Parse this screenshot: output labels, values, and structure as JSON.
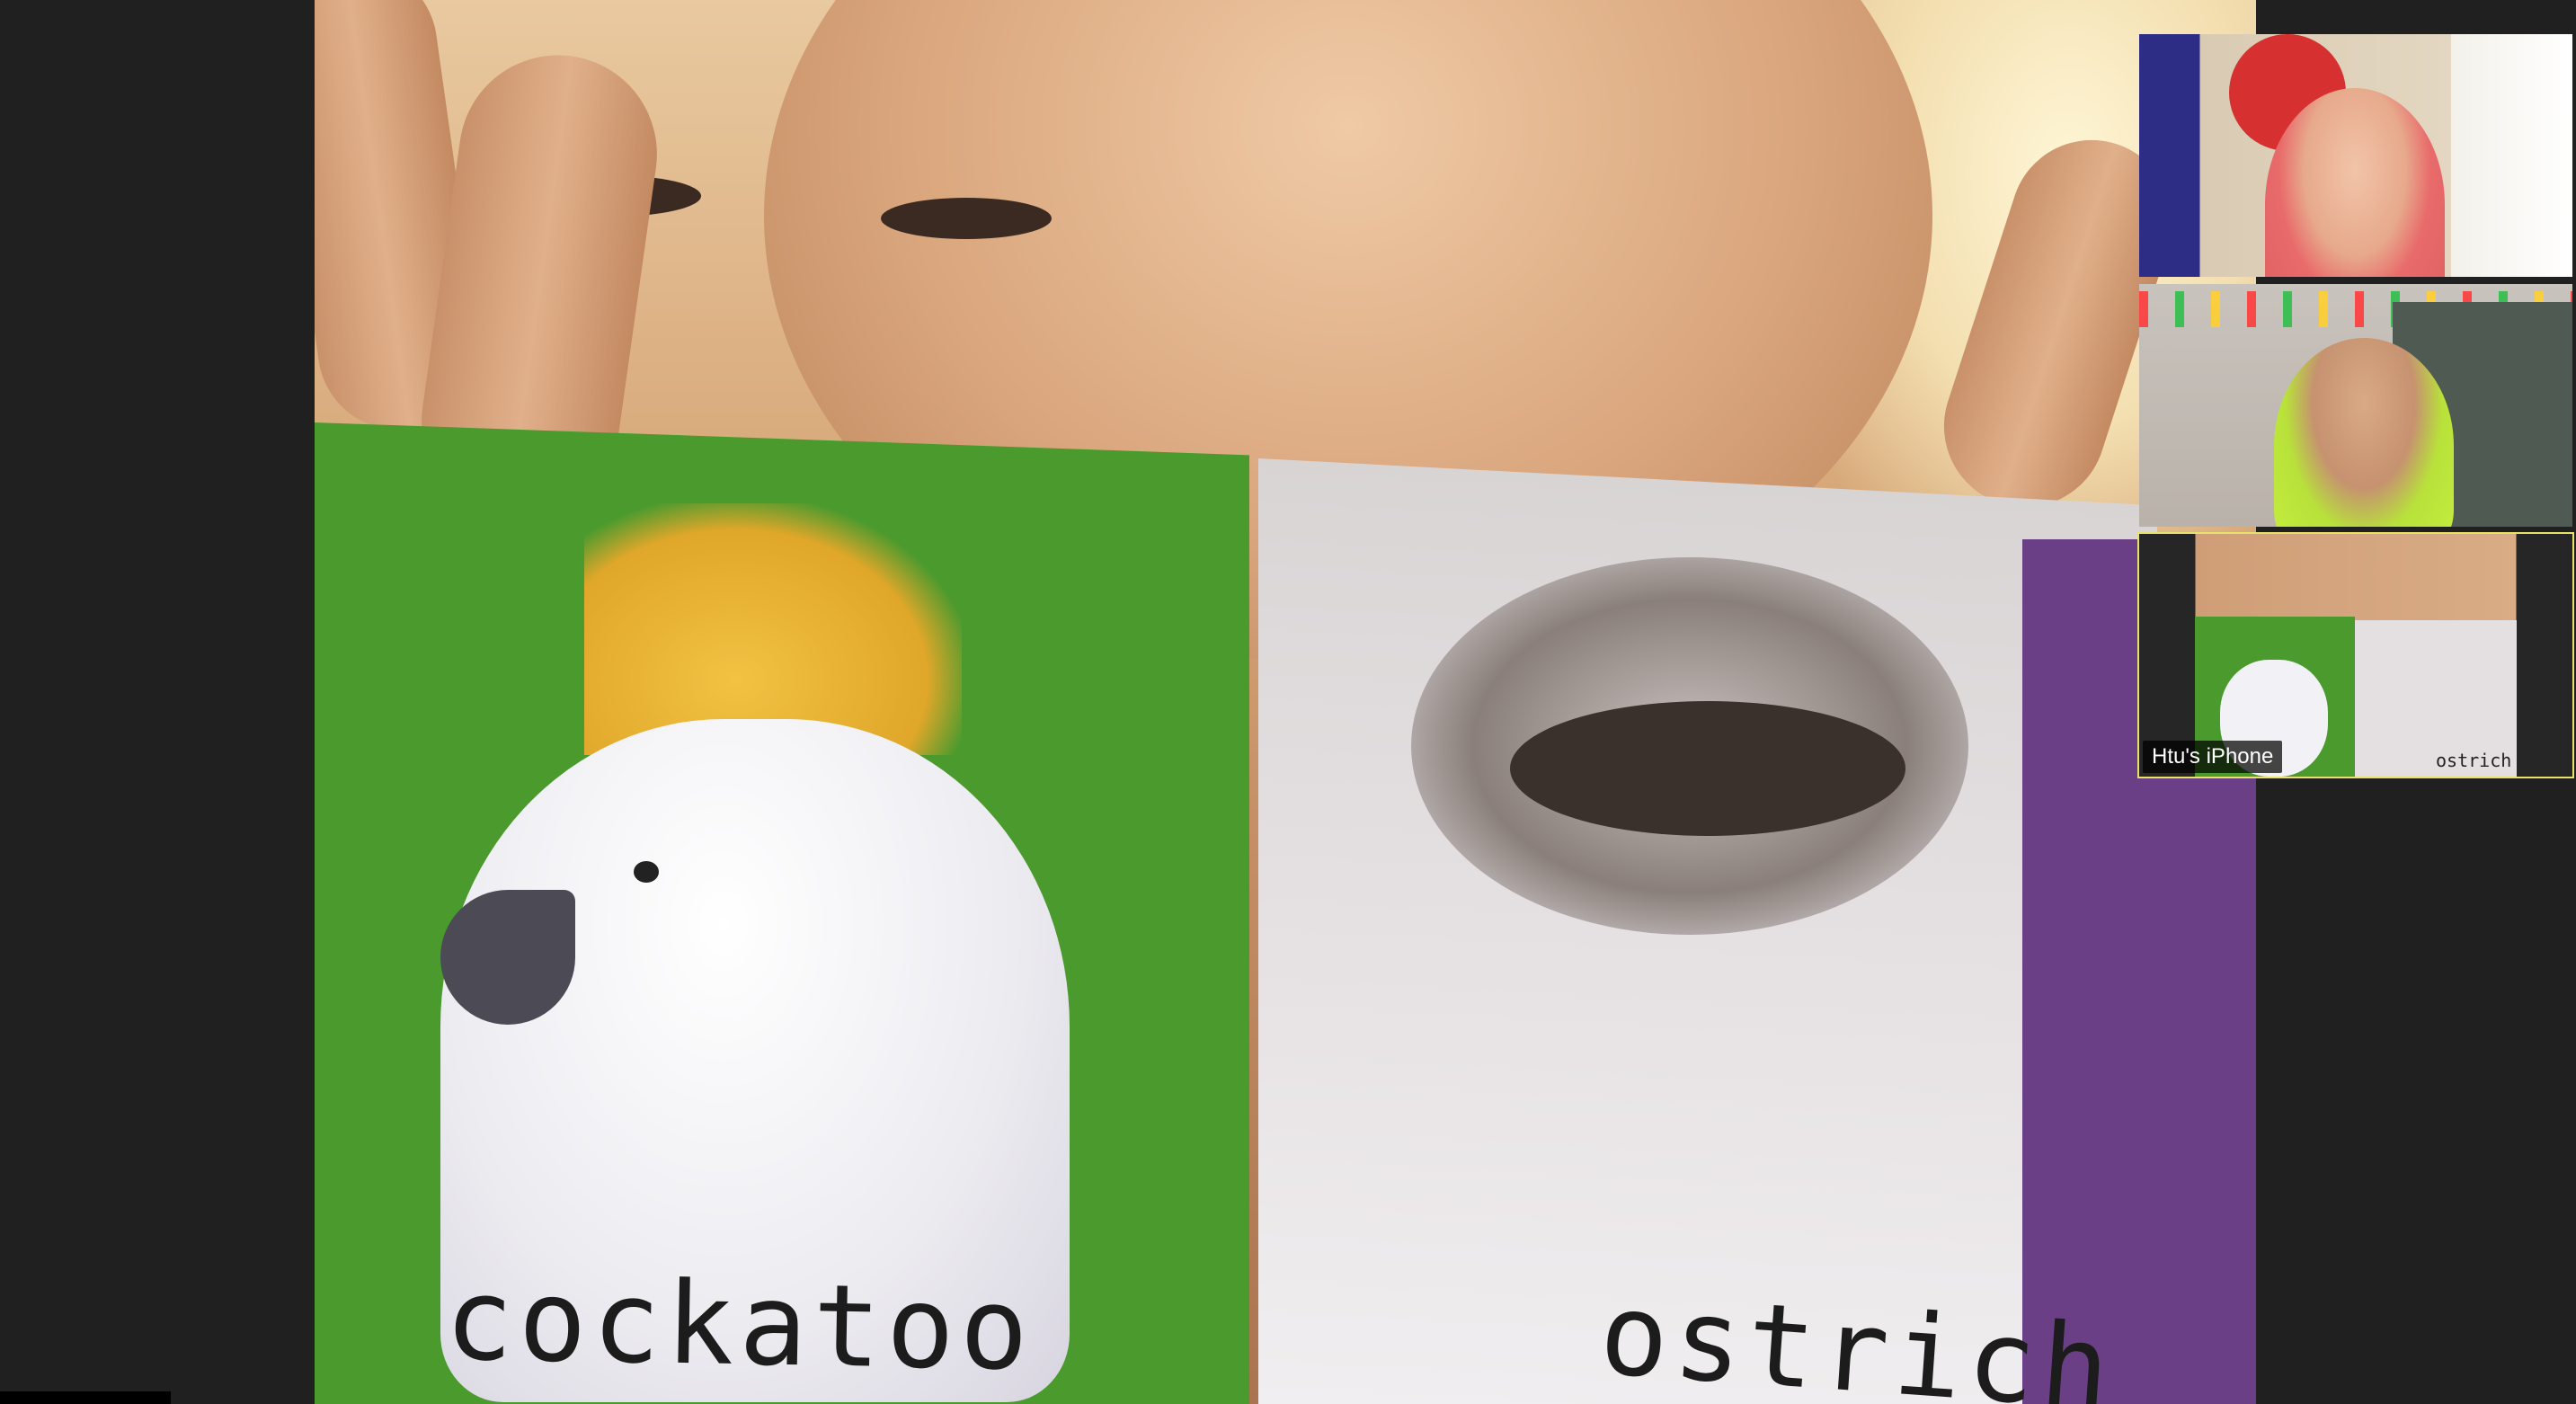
{
  "main_video": {
    "card_left_label": "cockatoo",
    "card_right_label": "ostrich"
  },
  "gallery": {
    "tiles": [
      {
        "participant": "participant-1"
      },
      {
        "participant": "participant-2"
      },
      {
        "participant": "participant-3",
        "name": "Htu's iPhone",
        "card_text": "ostrich",
        "active": true
      }
    ]
  },
  "colors": {
    "background": "#202020",
    "active_speaker_outline": "#e7e36a",
    "name_tag_bg": "#000000"
  }
}
